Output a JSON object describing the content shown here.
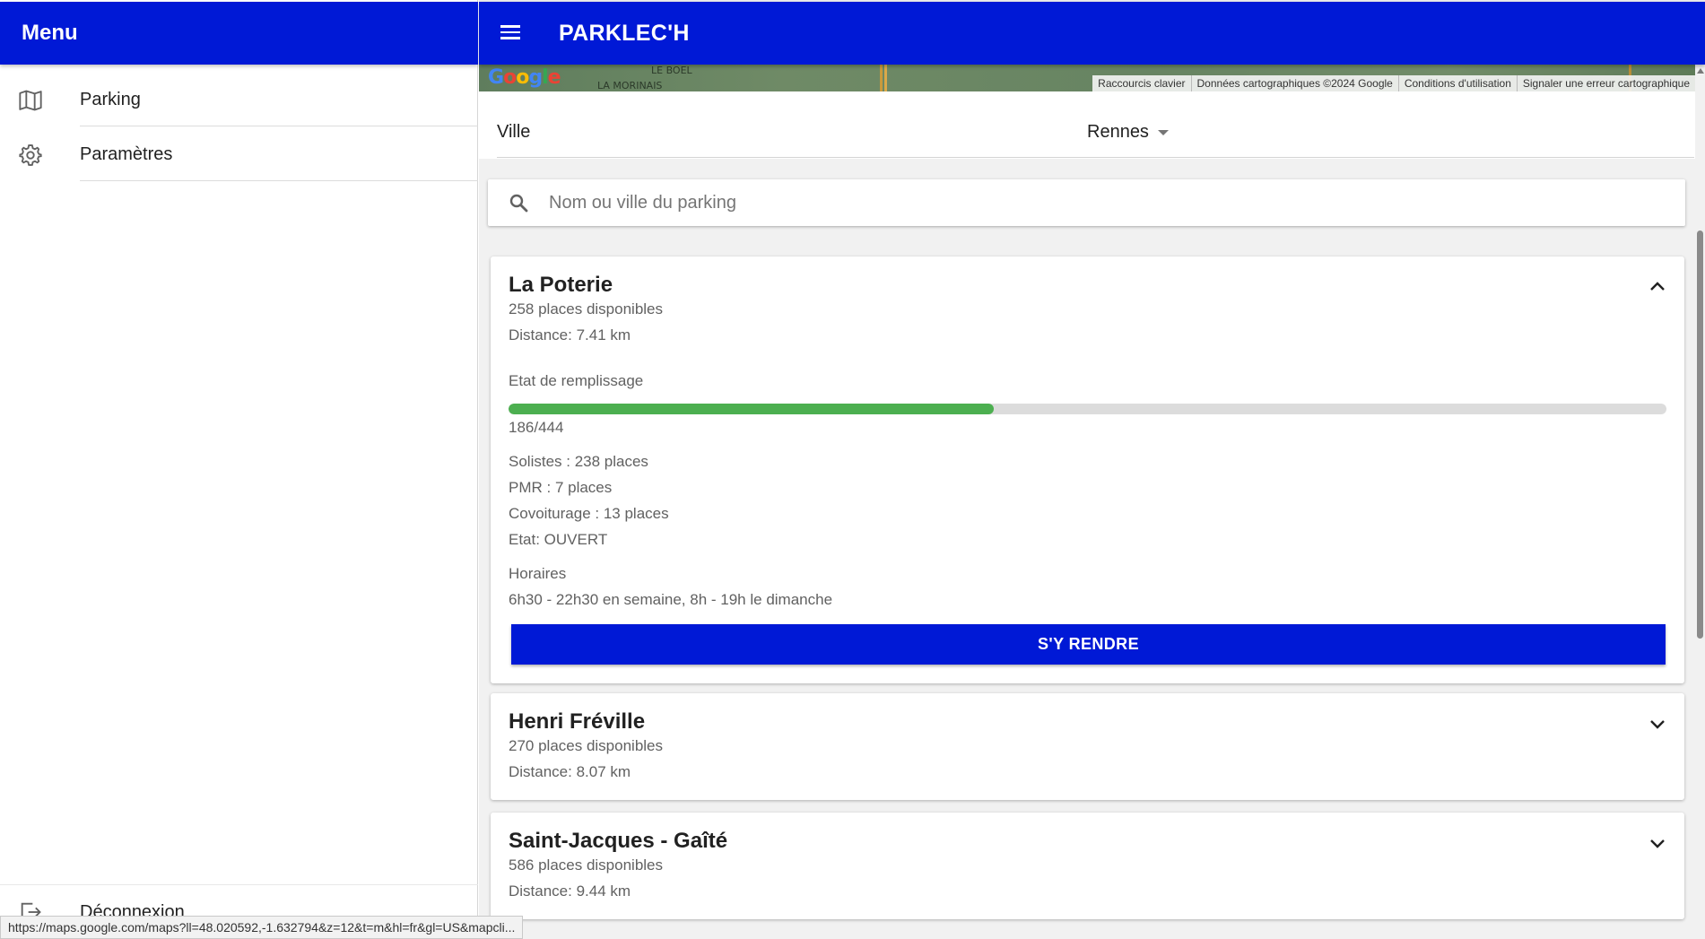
{
  "menu": {
    "title": "Menu",
    "items": [
      {
        "label": "Parking",
        "icon": "map-icon"
      },
      {
        "label": "Paramètres",
        "icon": "gear-icon"
      }
    ],
    "logout_label": "Déconnexion"
  },
  "appbar": {
    "title": "PARKLEC'H"
  },
  "map": {
    "place_labels": [
      "LE BOEL",
      "LA MORINAIS"
    ],
    "google_logo": "Google",
    "attribution": [
      "Raccourcis clavier",
      "Données cartographiques ©2024 Google",
      "Conditions d'utilisation",
      "Signaler une erreur cartographique"
    ]
  },
  "filter": {
    "label": "Ville",
    "value": "Rennes"
  },
  "search": {
    "placeholder": "Nom ou ville du parking",
    "value": ""
  },
  "parkings": [
    {
      "name": "La Poterie",
      "available": "258 places disponibles",
      "distance": "Distance: 7.41 km",
      "expanded": true,
      "fill_label": "Etat de remplissage",
      "fill_ratio": 0.419,
      "fill_text": "186/444",
      "details": [
        "Solistes : 238 places",
        "PMR : 7 places",
        "Covoiturage : 13 places",
        "Etat: OUVERT"
      ],
      "hours_label": "Horaires",
      "hours": "6h30 - 22h30 en semaine, 8h - 19h le dimanche",
      "action": "S'Y RENDRE"
    },
    {
      "name": "Henri Fréville",
      "available": "270 places disponibles",
      "distance": "Distance: 8.07 km",
      "expanded": false
    },
    {
      "name": "Saint-Jacques - Gaîté",
      "available": "586 places disponibles",
      "distance": "Distance: 9.44 km",
      "expanded": false
    }
  ],
  "status_bar": {
    "url": "https://maps.google.com/maps?ll=48.020592,-1.632794&z=12&t=m&hl=fr&gl=US&mapcli..."
  },
  "colors": {
    "primary": "#0019d6",
    "progress": "#4caf50"
  }
}
